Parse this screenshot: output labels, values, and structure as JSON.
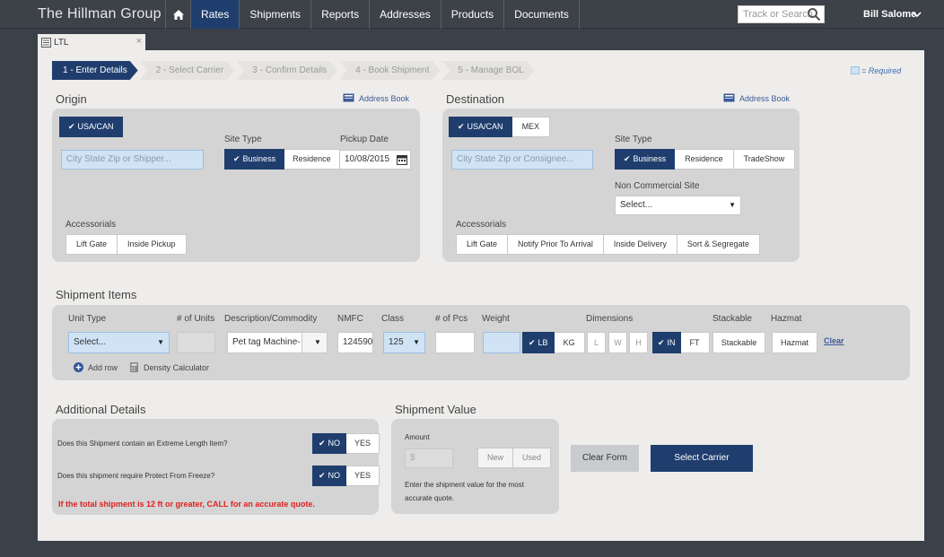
{
  "brand": "The Hillman Group",
  "nav": [
    "Rates",
    "Shipments",
    "Reports",
    "Addresses",
    "Products",
    "Documents"
  ],
  "search_placeholder": "Track or Search",
  "user": "Bill Salome",
  "doc_tab": "LTL",
  "steps": [
    "1 - Enter Details",
    "2 - Select Carrier",
    "3 - Confirm Details",
    "4 - Book Shipment",
    "5 - Manage BOL"
  ],
  "required_label": "= Required",
  "origin": {
    "title": "Origin",
    "address_book": "Address Book",
    "country": "USA/CAN",
    "city_placeholder": "City State Zip or Shipper...",
    "site_type_label": "Site Type",
    "site_types": [
      "Business",
      "Residence"
    ],
    "pickup_label": "Pickup Date",
    "pickup_date": "10/08/2015",
    "accessorials_label": "Accessorials",
    "accessorials": [
      "Lift Gate",
      "Inside Pickup"
    ]
  },
  "destination": {
    "title": "Destination",
    "address_book": "Address Book",
    "countries": [
      "USA/CAN",
      "MEX"
    ],
    "city_placeholder": "City State Zip or Consignee...",
    "site_type_label": "Site Type",
    "site_types": [
      "Business",
      "Residence",
      "TradeShow"
    ],
    "noncommercial_label": "Non Commercial Site",
    "noncommercial_value": "Select...",
    "accessorials_label": "Accessorials",
    "accessorials": [
      "Lift Gate",
      "Notify Prior To Arrival",
      "Inside Delivery",
      "Sort & Segregate"
    ]
  },
  "items": {
    "title": "Shipment Items",
    "headers": {
      "unit_type": "Unit Type",
      "units": "# of Units",
      "desc": "Description/Commodity",
      "nmfc": "NMFC",
      "class": "Class",
      "pcs": "# of Pcs",
      "weight": "Weight",
      "dims": "Dimensions",
      "stackable": "Stackable",
      "hazmat": "Hazmat"
    },
    "unit_type_value": "Select...",
    "desc_value": "Pet tag Machine-",
    "nmfc_value": "124590",
    "class_value": "125",
    "weight_units": [
      "LB",
      "KG"
    ],
    "dim_fields": [
      "L",
      "W",
      "H"
    ],
    "dim_units": [
      "IN",
      "FT"
    ],
    "stackable_btn": "Stackable",
    "hazmat_btn": "Hazmat",
    "clear": "Clear",
    "add_row": "Add row",
    "density": "Density Calculator"
  },
  "additional": {
    "title": "Additional Details",
    "q1": "Does this Shipment contain an Extreme Length Item?",
    "q2": "Does this shipment require Protect From Freeze?",
    "no": "NO",
    "yes": "YES",
    "warning": "If the total shipment is 12 ft or greater, CALL for an accurate quote."
  },
  "value": {
    "title": "Shipment Value",
    "amount_label": "Amount",
    "amount_placeholder": "$",
    "conditions": [
      "New",
      "Used"
    ],
    "hint": "Enter the shipment value for the most accurate quote."
  },
  "actions": {
    "clear_form": "Clear Form",
    "select_carrier": "Select Carrier"
  }
}
